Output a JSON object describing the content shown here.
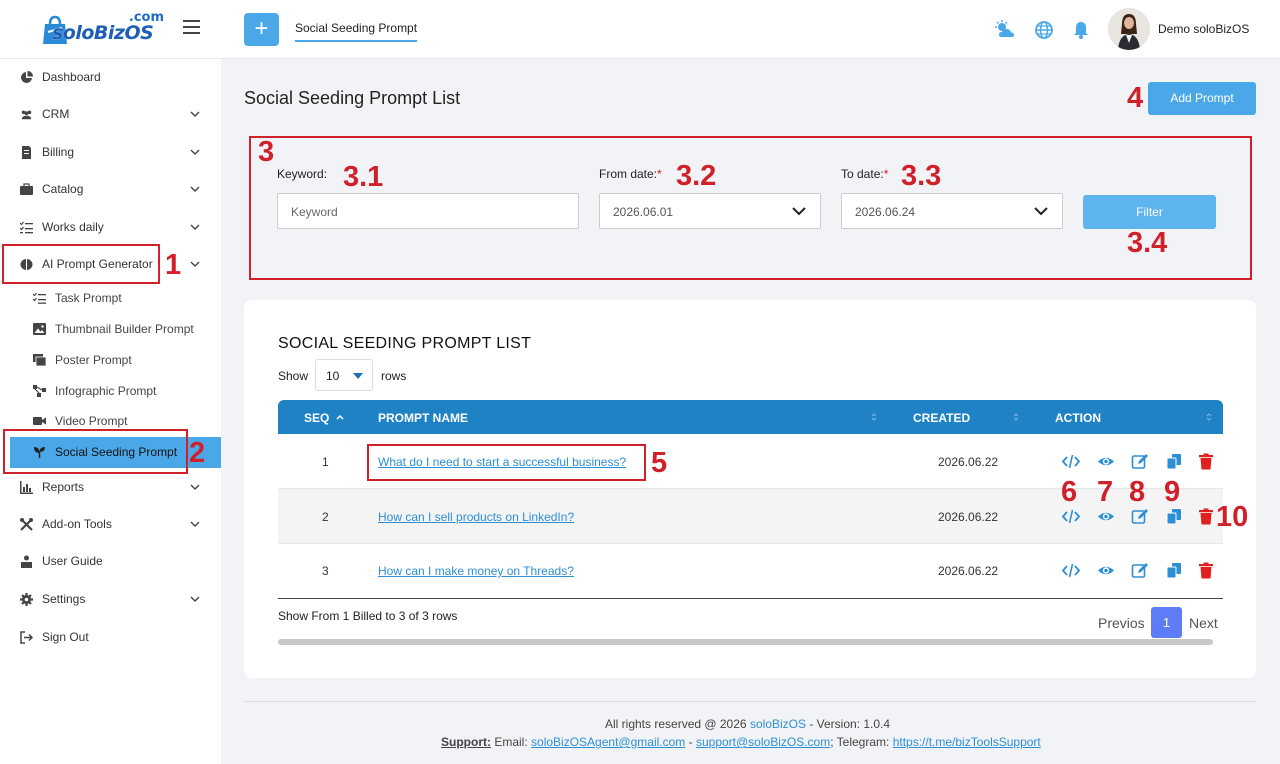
{
  "app": {
    "logo_text": "soloBizOS",
    "logo_suffix": ".com",
    "active_tab": "Social Seeding Prompt",
    "user_name": "Demo soloBizOS"
  },
  "sidebar": {
    "items": [
      {
        "label": "Dashboard",
        "icon": "pie-chart-icon",
        "has_children": false
      },
      {
        "label": "CRM",
        "icon": "users-icon",
        "has_children": true
      },
      {
        "label": "Billing",
        "icon": "invoice-icon",
        "has_children": true
      },
      {
        "label": "Catalog",
        "icon": "briefcase-icon",
        "has_children": true
      },
      {
        "label": "Works daily",
        "icon": "checklist-icon",
        "has_children": true
      },
      {
        "label": "AI Prompt Generator",
        "icon": "brain-icon",
        "has_children": true,
        "expanded": true
      },
      {
        "label": "Reports",
        "icon": "bar-chart-icon",
        "has_children": true
      },
      {
        "label": "Add-on Tools",
        "icon": "tools-icon",
        "has_children": true
      },
      {
        "label": "User Guide",
        "icon": "user-guide-icon",
        "has_children": false
      },
      {
        "label": "Settings",
        "icon": "gear-icon",
        "has_children": true
      },
      {
        "label": "Sign Out",
        "icon": "sign-out-icon",
        "has_children": false
      }
    ],
    "sub_items": [
      {
        "label": "Task Prompt",
        "icon": "task-list-icon"
      },
      {
        "label": "Thumbnail Builder Prompt",
        "icon": "image-icon"
      },
      {
        "label": "Poster Prompt",
        "icon": "poster-icon"
      },
      {
        "label": "Infographic Prompt",
        "icon": "diagram-icon"
      },
      {
        "label": "Video Prompt",
        "icon": "video-icon"
      },
      {
        "label": "Social Seeding Prompt",
        "icon": "seedling-icon",
        "active": true
      }
    ]
  },
  "page": {
    "title": "Social Seeding Prompt List",
    "add_button": "Add Prompt"
  },
  "filter": {
    "keyword_label": "Keyword:",
    "keyword_placeholder": "Keyword",
    "from_label": "From date:",
    "from_value": "2026.06.01",
    "to_label": "To date:",
    "to_value": "2026.06.24",
    "required_mark": "*",
    "filter_button": "Filter"
  },
  "list": {
    "title": "SOCIAL SEEDING PROMPT LIST",
    "show_label": "Show",
    "rows_value": "10",
    "rows_label": "rows",
    "columns": [
      "SEQ",
      "PROMPT NAME",
      "CREATED",
      "ACTION"
    ],
    "rows": [
      {
        "seq": "1",
        "name": "What do I need to start a successful business?",
        "created": "2026.06.22"
      },
      {
        "seq": "2",
        "name": "How can I sell products on LinkedIn?",
        "created": "2026.06.22"
      },
      {
        "seq": "3",
        "name": "How can I make money on Threads?",
        "created": "2026.06.22"
      }
    ],
    "actions": [
      "code-icon",
      "eye-icon",
      "edit-icon",
      "copy-icon",
      "trash-icon"
    ],
    "info": "Show From 1 Billed to 3 of 3 rows",
    "prev": "Previos",
    "page": "1",
    "next": "Next"
  },
  "annotations": {
    "n1": "1",
    "n2": "2",
    "n3": "3",
    "n3_1": "3.1",
    "n3_2": "3.2",
    "n3_3": "3.3",
    "n3_4": "3.4",
    "n4": "4",
    "n5": "5",
    "n6": "6",
    "n7": "7",
    "n8": "8",
    "n9": "9",
    "n10": "10"
  },
  "footer": {
    "rights": "All rights reserved @ 2026",
    "brand": "soloBizOS",
    "version": "- Version: 1.0.4",
    "support_label": "Support:",
    "email_label": "Email:",
    "email1": "soloBizOSAgent@gmail.com",
    "sep": "-",
    "email2": "support@soloBizOS.com",
    "telegram_label": "; Telegram:",
    "telegram": "https://t.me/bizToolsSupport"
  },
  "colors": {
    "accent": "#4aa8e8",
    "table_header": "#1e82c4",
    "link": "#2c8fd6",
    "annotation": "#d0202a",
    "pager": "#5d7cf5"
  }
}
